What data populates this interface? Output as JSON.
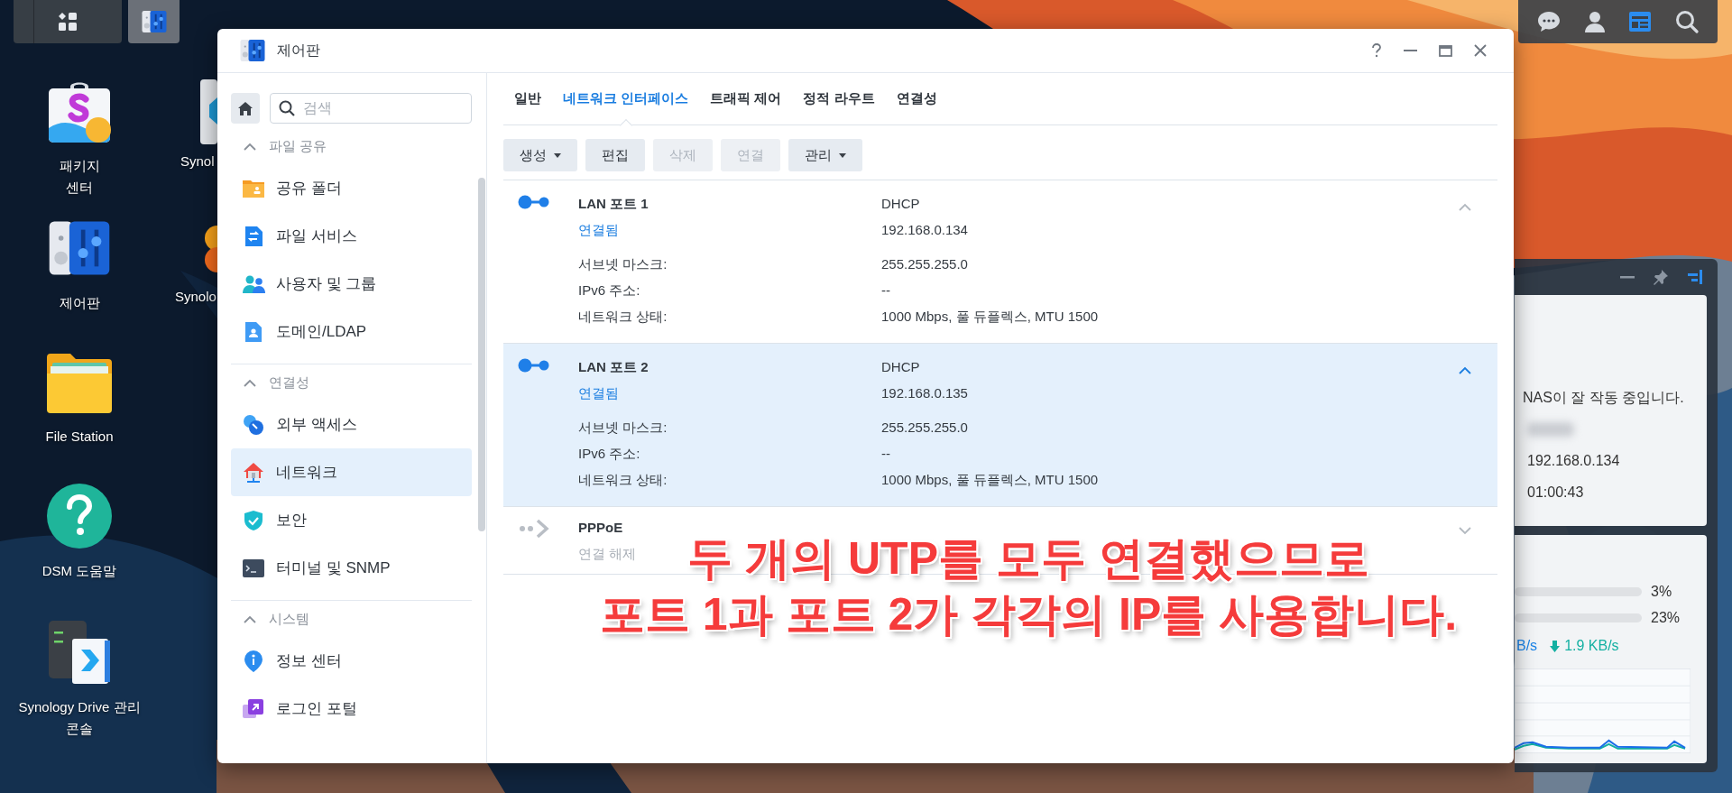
{
  "taskbar": {
    "left": [
      {
        "kind": "apps",
        "selected": false
      },
      {
        "kind": "control_panel",
        "selected": true
      }
    ],
    "right": [
      {
        "kind": "chat",
        "selected": false
      },
      {
        "kind": "user",
        "selected": false
      },
      {
        "kind": "widgets",
        "selected": true
      },
      {
        "kind": "search",
        "selected": false
      }
    ]
  },
  "desktop_icons": [
    {
      "kind": "package",
      "label": "패키지\n센터"
    },
    {
      "kind": "control_panel",
      "label": "제어판"
    },
    {
      "kind": "file_station",
      "label": "File Station"
    },
    {
      "kind": "help",
      "label": "DSM 도움말"
    },
    {
      "kind": "drive",
      "label": "Synology Drive 관리\n콘솔"
    },
    {
      "kind": "cut_grey",
      "label": "Synol"
    },
    {
      "kind": "cut_orange",
      "label": "Synolo"
    }
  ],
  "widget": {
    "status": "NAS이 잘 작동 중입니다.",
    "values": [
      "192.168.0.134",
      "01:00:43"
    ],
    "usage": [
      "3%",
      "23%"
    ],
    "upload": "B/s",
    "download": "1.9 KB/s"
  },
  "window": {
    "title": "제어판",
    "controls": [
      {
        "kind": "help"
      },
      {
        "kind": "minimize"
      },
      {
        "kind": "maximize"
      },
      {
        "kind": "close"
      }
    ]
  },
  "sidebar": {
    "search": {
      "placeholder": "검색"
    },
    "sections": [
      {
        "title": "파일 공유",
        "expanded": true,
        "items": [
          {
            "label": "공유 폴더",
            "kind": "shared_folder",
            "selected": false
          },
          {
            "label": "파일 서비스",
            "kind": "file_services",
            "selected": false
          },
          {
            "label": "사용자 및 그룹",
            "kind": "users",
            "selected": false
          },
          {
            "label": "도메인/LDAP",
            "kind": "domain",
            "selected": false
          }
        ]
      },
      {
        "title": "연결성",
        "expanded": true,
        "items": [
          {
            "label": "외부 액세스",
            "kind": "external",
            "selected": false
          },
          {
            "label": "네트워크",
            "kind": "network",
            "selected": true
          },
          {
            "label": "보안",
            "kind": "security",
            "selected": false
          },
          {
            "label": "터미널 및 SNMP",
            "kind": "terminal",
            "selected": false
          }
        ]
      },
      {
        "title": "시스템",
        "expanded": true,
        "items": [
          {
            "label": "정보 센터",
            "kind": "info",
            "selected": false
          },
          {
            "label": "로그인 포털",
            "kind": "portal",
            "selected": false
          }
        ]
      }
    ]
  },
  "tabs": [
    {
      "label": "일반",
      "selected": false
    },
    {
      "label": "네트워크 인터페이스",
      "selected": true
    },
    {
      "label": "트래픽 제어",
      "selected": false
    },
    {
      "label": "정적 라우트",
      "selected": false
    },
    {
      "label": "연결성",
      "selected": false
    }
  ],
  "toolbar": [
    {
      "label": "생성",
      "dropdown": true,
      "disabled": false
    },
    {
      "label": "편집",
      "dropdown": false,
      "disabled": false
    },
    {
      "label": "삭제",
      "dropdown": false,
      "disabled": true
    },
    {
      "label": "연결",
      "dropdown": false,
      "disabled": true
    },
    {
      "label": "관리",
      "dropdown": true,
      "disabled": false
    }
  ],
  "interfaces": [
    {
      "kind": "lan",
      "name": "LAN 포트 1",
      "status": "연결됨",
      "connected": true,
      "mode": "DHCP",
      "ip": "192.168.0.134",
      "expanded": true,
      "selected": false,
      "details": [
        {
          "label": "서브넷 마스크:",
          "value": "255.255.255.0"
        },
        {
          "label": "IPv6 주소:",
          "value": "--"
        },
        {
          "label": "네트워크 상태:",
          "value": "1000 Mbps, 풀 듀플렉스, MTU 1500"
        }
      ]
    },
    {
      "kind": "lan",
      "name": "LAN 포트 2",
      "status": "연결됨",
      "connected": true,
      "mode": "DHCP",
      "ip": "192.168.0.135",
      "expanded": true,
      "selected": true,
      "details": [
        {
          "label": "서브넷 마스크:",
          "value": "255.255.255.0"
        },
        {
          "label": "IPv6 주소:",
          "value": "--"
        },
        {
          "label": "네트워크 상태:",
          "value": "1000 Mbps, 풀 듀플렉스, MTU 1500"
        }
      ]
    },
    {
      "kind": "pppoe",
      "name": "PPPoE",
      "status": "연결 해제",
      "connected": false,
      "expanded": false,
      "selected": false
    }
  ],
  "annotation": [
    "두 개의 UTP를 모두 연결했으므로",
    "포트 1과 포트 2가 각각의 IP를 사용합니다."
  ]
}
